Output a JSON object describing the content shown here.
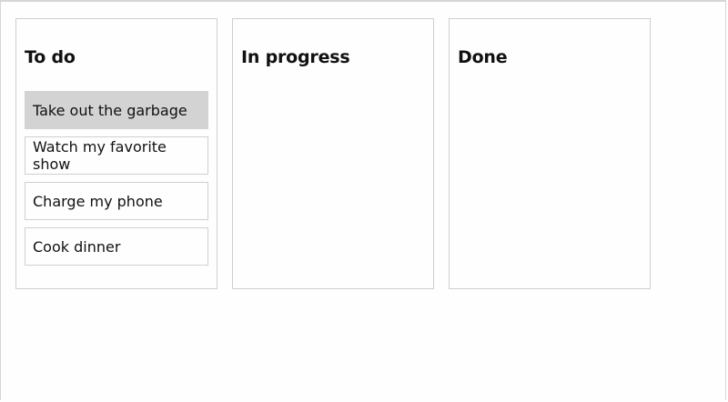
{
  "board": {
    "columns": [
      {
        "title": "To do",
        "cards": [
          {
            "label": "Take out the garbage"
          },
          {
            "label": "Watch my favorite show"
          },
          {
            "label": "Charge my phone"
          },
          {
            "label": "Cook dinner"
          }
        ]
      },
      {
        "title": "In progress",
        "cards": []
      },
      {
        "title": "Done",
        "cards": []
      }
    ]
  }
}
